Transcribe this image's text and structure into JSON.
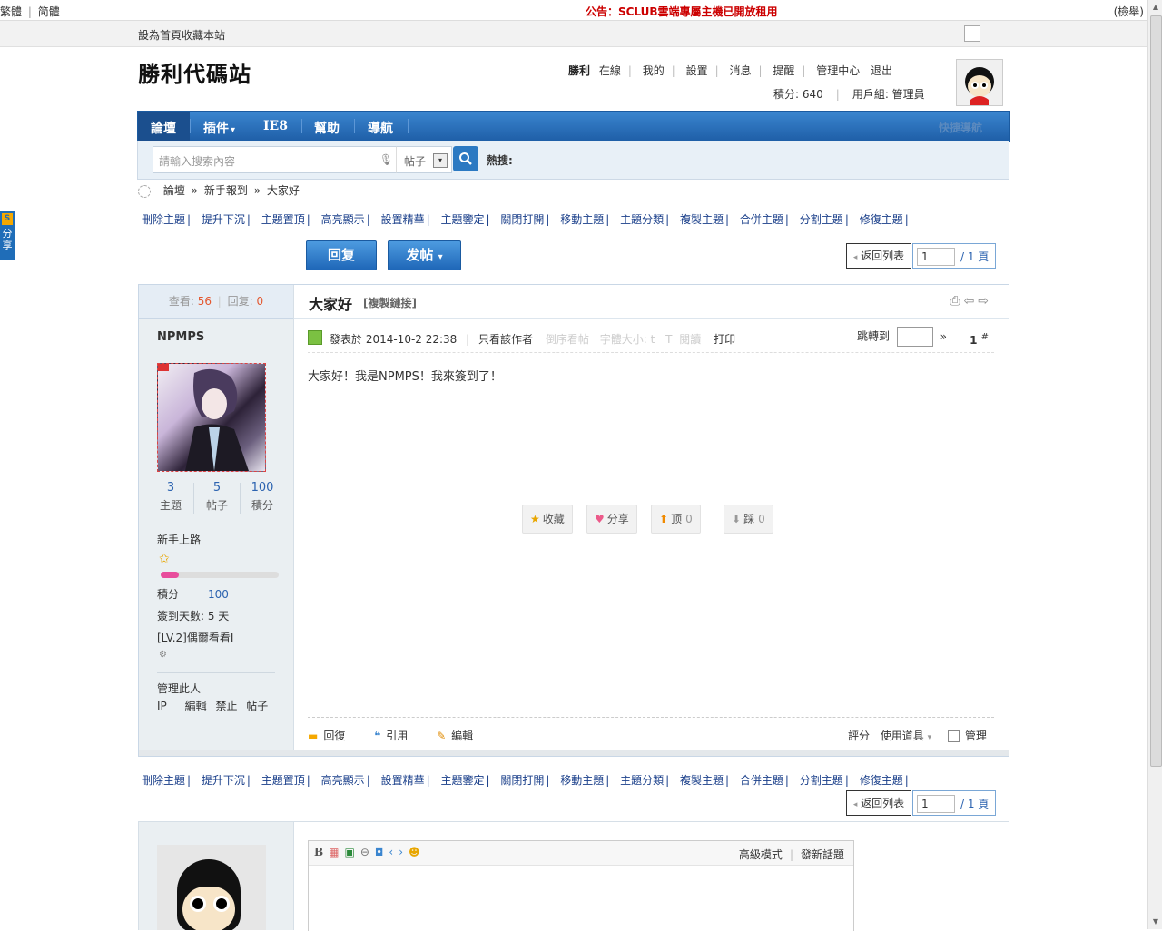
{
  "topbar": {
    "lang_trad": "繁體",
    "lang_simp": "简體",
    "lang_sep": "|",
    "notice": "公告：SCLUB雲端專屬主機已開放租用",
    "search": "(檢舉)"
  },
  "toolbar": {
    "set_home": "設為首頁",
    "bookmark": "收藏本站"
  },
  "header": {
    "logo": "勝利代碼站",
    "username": "勝利",
    "nav": [
      "在線",
      "我的",
      "設置",
      "消息",
      "提醒",
      "管理中心",
      "退出"
    ],
    "points_label": "積分: 640",
    "group_label": "用戶組: 管理員"
  },
  "mainnav": {
    "items": [
      "論壇",
      "插件",
      "IE8",
      "幫助",
      "導航"
    ],
    "plugin_arrow": "▾",
    "right_link": "快捷導航"
  },
  "search": {
    "placeholder": "請輸入搜索內容",
    "mic_icon": "microphone-icon",
    "type": "帖子",
    "dropdown_arrow": "▾",
    "button_icon": "search-icon",
    "hot_label": "熱搜:"
  },
  "breadcrumb": {
    "items": [
      "論壇",
      "新手報到",
      "大家好"
    ],
    "separator": "»"
  },
  "mod_actions": [
    "刪除主題",
    "提升下沉",
    "主題置頂",
    "高亮顯示",
    "設置精華",
    "主題鑒定",
    "關閉打開",
    "移動主題",
    "主題分類",
    "複製主題",
    "合併主題",
    "分割主題",
    "修復主題"
  ],
  "mod_sep": "|",
  "buttons": {
    "reply": "回复",
    "post": "发帖",
    "post_arrow": "▾"
  },
  "pager": {
    "back": "返回列表",
    "page": "1",
    "total": "/ 1 頁"
  },
  "post": {
    "views_label": "查看:",
    "views": "56",
    "replies_label": "回复:",
    "replies": "0",
    "title": "大家好",
    "copy_link": "[複製鏈接]",
    "author": "NPMPS",
    "stats": [
      {
        "value": "3",
        "label": "主題"
      },
      {
        "value": "5",
        "label": "帖子"
      },
      {
        "value": "100",
        "label": "積分"
      }
    ],
    "rank": "新手上路",
    "progress": 0.15,
    "points_label": "積分",
    "points_value": "100",
    "checkin": "簽到天數: 5 天",
    "level": "[LV.2]偶爾看看I",
    "manage_label": "管理此人",
    "manage_links": [
      "IP",
      "編輯",
      "禁止",
      "帖子"
    ],
    "posted_on": "發表於 2014-10-2 22:38",
    "only_author": "只看該作者",
    "reverse": "倒序看帖",
    "font_size": "字體大小: t",
    "read_mode": "閱讀",
    "print": "打印",
    "jump_to": "跳轉到",
    "jump_arrow": "»",
    "floor": "1",
    "floor_mark": "#",
    "content": "大家好！我是NPMPS！我來簽到了！",
    "reactions": [
      {
        "icon": "star-icon",
        "label": "收藏",
        "count": ""
      },
      {
        "icon": "heart-icon",
        "label": "分享",
        "count": ""
      },
      {
        "icon": "thumb-up-icon",
        "label": "顶",
        "count": "0"
      },
      {
        "icon": "thumb-down-icon",
        "label": "踩",
        "count": "0"
      }
    ],
    "footer": [
      "回復",
      "引用",
      "編輯"
    ],
    "rate": "評分",
    "use_item": "使用道具",
    "use_arrow": "▾",
    "manage": "管理"
  },
  "reply_editor": {
    "toolbar_icons": [
      "bold-icon",
      "color-icon",
      "image-icon",
      "link-icon",
      "quote-icon",
      "code-icon",
      "smiley-icon"
    ],
    "bold_glyph": "B",
    "advanced": "高級模式",
    "new_topic": "發新話題"
  },
  "sharetab": {
    "badge": "S",
    "label": "分享"
  }
}
